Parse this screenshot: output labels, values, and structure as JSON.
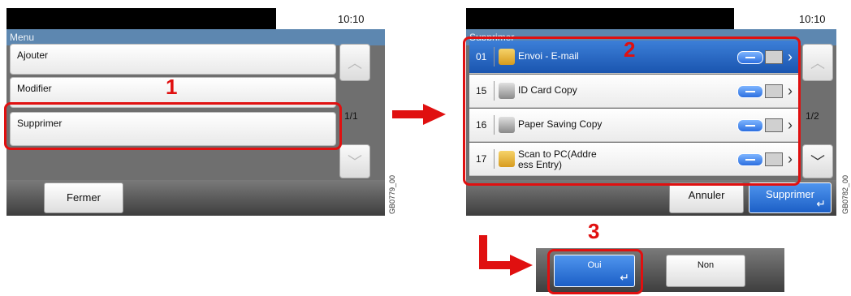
{
  "left_screen": {
    "clock": "10:10",
    "title": "Menu",
    "items": [
      "Ajouter",
      "Modifier",
      "Supprimer"
    ],
    "page": "1/1",
    "close_label": "Fermer",
    "code": "GB0779_00",
    "step": "1"
  },
  "right_screen": {
    "clock": "10:10",
    "title": "Supprimer",
    "rows": [
      {
        "num": "01",
        "title": "Envoi - E-mail",
        "icon": "email-folder-icon",
        "selected": true
      },
      {
        "num": "15",
        "title": "ID Card Copy",
        "icon": "copy-icon",
        "selected": false
      },
      {
        "num": "16",
        "title": "Paper Saving Copy",
        "icon": "copy-icon",
        "selected": false
      },
      {
        "num": "17",
        "title": "Scan to PC(Addre ess Entry)",
        "icon": "folder-icon",
        "selected": false
      }
    ],
    "page": "1/2",
    "cancel_label": "Annuler",
    "delete_label": "Supprimer",
    "code": "GB0782_00",
    "step": "2"
  },
  "confirm": {
    "yes_label": "Oui",
    "no_label": "Non",
    "step": "3"
  },
  "colors": {
    "accent": "#1a55b0",
    "highlight": "#e01010",
    "title_bar": "#5d87b0"
  }
}
